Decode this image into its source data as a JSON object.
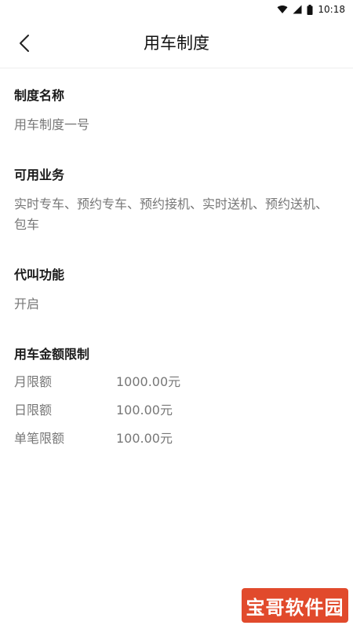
{
  "status_bar": {
    "time": "10:18"
  },
  "header": {
    "title": "用车制度"
  },
  "sections": {
    "policy_name": {
      "title": "制度名称",
      "value": "用车制度一号"
    },
    "services": {
      "title": "可用业务",
      "value": "实时专车、预约专车、预约接机、实时送机、预约送机、包车"
    },
    "proxy_call": {
      "title": "代叫功能",
      "value": "开启"
    },
    "amount_limits": {
      "title": "用车金额限制",
      "rows": [
        {
          "label": "月限额",
          "value": "1000.00元"
        },
        {
          "label": "日限额",
          "value": "100.00元"
        },
        {
          "label": "单笔限额",
          "value": "100.00元"
        }
      ]
    }
  },
  "watermark": {
    "text": "宝哥软件园",
    "color": "#e14a2c"
  },
  "colors": {
    "title_text": "#1a1a1a",
    "value_text": "#777777",
    "divider": "#eeeeee"
  }
}
